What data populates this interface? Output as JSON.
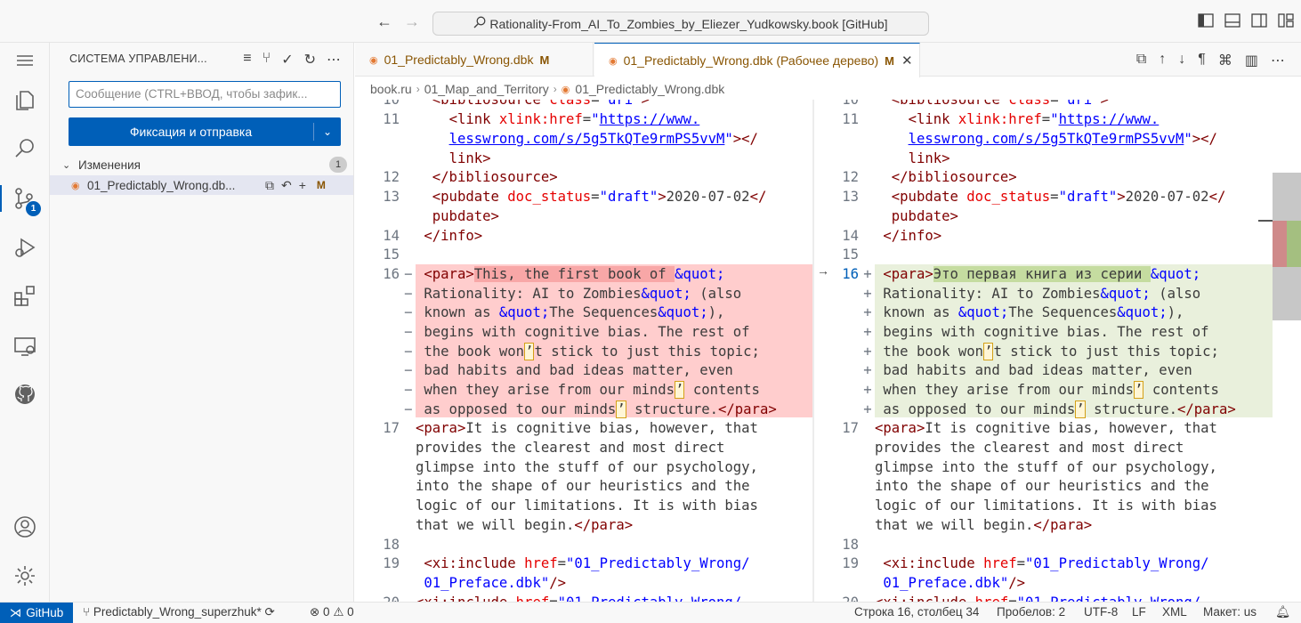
{
  "titlebar": {
    "search_text": "Rationality-From_AI_To_Zombies_by_Eliezer_Yudkowsky.book [GitHub]",
    "back": "←",
    "forward": "→"
  },
  "activity": {
    "scm_badge": "1"
  },
  "sidebar": {
    "title": "СИСТЕМА УПРАВЛЕНИ...",
    "commit_placeholder": "Сообщение (CTRL+ВВОД, чтобы зафик...",
    "commit_button": "Фиксация и отправка",
    "changes_label": "Изменения",
    "changes_count": "1",
    "file_name": "01_Predictably_Wrong.db...",
    "file_status": "M"
  },
  "tabs": [
    {
      "label": "01_Predictably_Wrong.dbk",
      "status": "M"
    },
    {
      "label": "01_Predictably_Wrong.dbk (Рабочее дерево)",
      "status": "M"
    }
  ],
  "breadcrumb": {
    "root": "book.ru",
    "folder": "01_Map_and_Territory",
    "file": "01_Predictably_Wrong.dbk"
  },
  "statusbar": {
    "remote": "GitHub",
    "branch": "Predictably_Wrong_superzhuk*",
    "problems": "⊗ 0 ⚠ 0",
    "position": "Строка 16, столбец 34",
    "spaces": "Пробелов: 2",
    "encoding": "UTF-8",
    "eol": "LF",
    "language": "XML",
    "layout": "Макет: us"
  },
  "colors": {
    "accent": "#005fb8",
    "deleted": "#ffcdcd",
    "inserted": "#e9f0dc"
  }
}
